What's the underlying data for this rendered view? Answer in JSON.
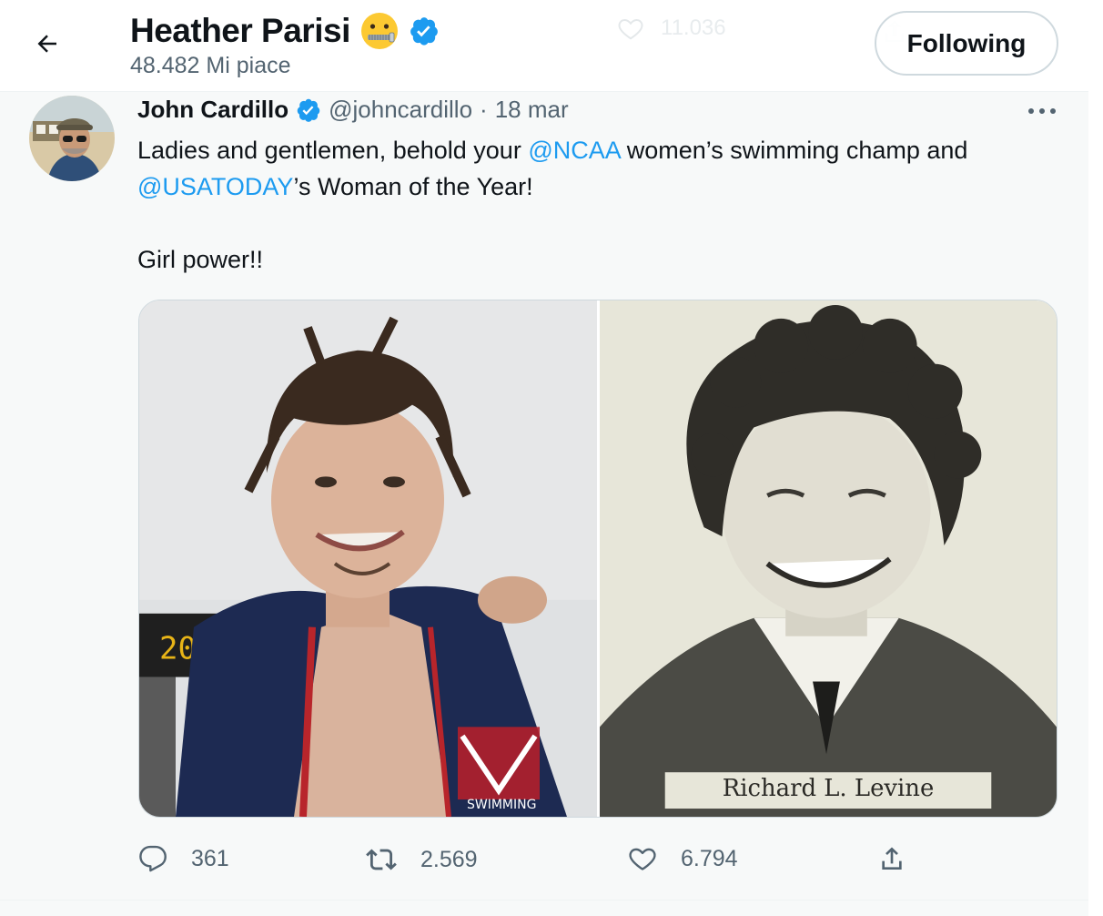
{
  "header": {
    "back_label": "Back",
    "title": "Heather Parisi",
    "subtitle": "48.482 Mi piace",
    "follow_label": "Following",
    "ghost_count": "11.036"
  },
  "tweet": {
    "author_name": "John Cardillo",
    "author_handle": "@johncardillo",
    "separator": "·",
    "date": "18 mar",
    "text": {
      "line1_pre": "Ladies and gentlemen, behold your ",
      "mention1": "@NCAA",
      "line1_post": " women’s swimming champ and",
      "mention2": "@USATODAY",
      "line2_post": "’s Woman of the Year!",
      "line3": "Girl power!!"
    },
    "media": {
      "right_caption": "Richard L. Levine",
      "left_scoreboard": "20",
      "left_logo_text": "SWIMMING"
    },
    "actions": {
      "replies": "361",
      "retweets": "2.569",
      "likes": "6.794"
    }
  },
  "colors": {
    "accent": "#1d9bf0",
    "text_primary": "#0f1419",
    "text_secondary": "#536471",
    "background": "#f7f9f9"
  }
}
